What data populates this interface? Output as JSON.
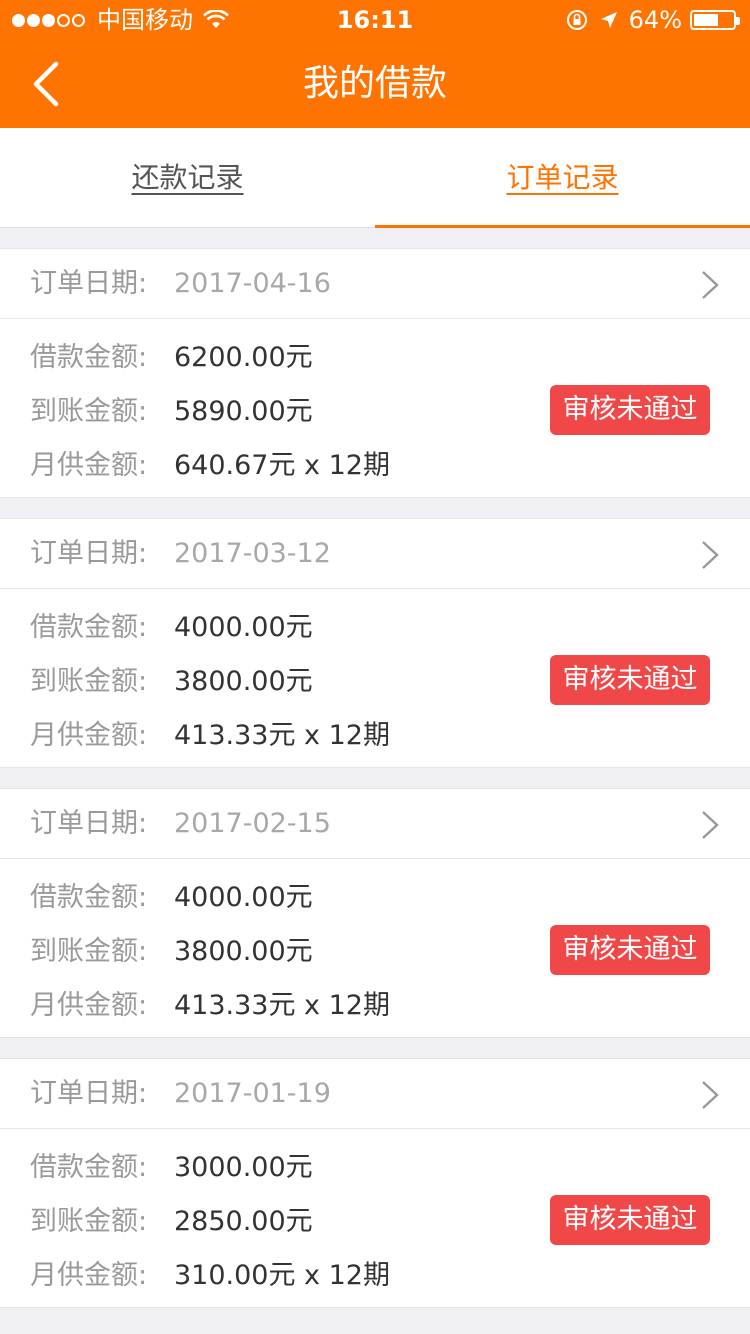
{
  "status_bar": {
    "carrier": "中国移动",
    "time": "16:11",
    "battery_text": "64%",
    "battery_level": 0.64
  },
  "navbar": {
    "title": "我的借款"
  },
  "tabs": [
    {
      "label": "还款记录",
      "active": false
    },
    {
      "label": "订单记录",
      "active": true
    }
  ],
  "orders": [
    {
      "date_label": "订单日期:",
      "date": "2017-04-16",
      "loan_label": "借款金额:",
      "loan": "6200.00元",
      "received_label": "到账金额:",
      "received": "5890.00元",
      "monthly_label": "月供金额:",
      "monthly": "640.67元 x 12期",
      "status": "审核未通过"
    },
    {
      "date_label": "订单日期:",
      "date": "2017-03-12",
      "loan_label": "借款金额:",
      "loan": "4000.00元",
      "received_label": "到账金额:",
      "received": "3800.00元",
      "monthly_label": "月供金额:",
      "monthly": "413.33元 x 12期",
      "status": "审核未通过"
    },
    {
      "date_label": "订单日期:",
      "date": "2017-02-15",
      "loan_label": "借款金额:",
      "loan": "4000.00元",
      "received_label": "到账金额:",
      "received": "3800.00元",
      "monthly_label": "月供金额:",
      "monthly": "413.33元 x 12期",
      "status": "审核未通过"
    },
    {
      "date_label": "订单日期:",
      "date": "2017-01-19",
      "loan_label": "借款金额:",
      "loan": "3000.00元",
      "received_label": "到账金额:",
      "received": "2850.00元",
      "monthly_label": "月供金额:",
      "monthly": "310.00元 x 12期",
      "status": "审核未通过"
    }
  ],
  "colors": {
    "brand": "#ff7300",
    "status_badge": "#f04848"
  }
}
